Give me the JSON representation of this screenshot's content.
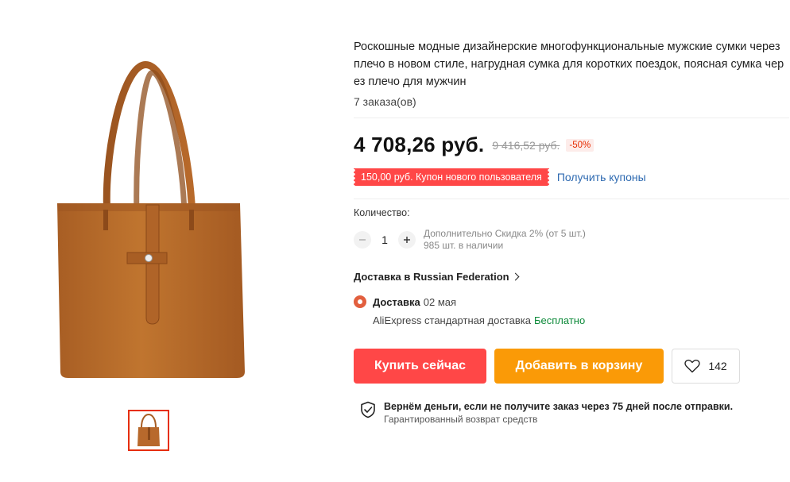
{
  "product": {
    "title": "Роскошные модные дизайнерские многофункциональные мужские сумки через плечо в новом стиле, нагрудная сумка для коротких поездок, поясная сумка через плечо для мужчин",
    "orders": "7 заказа(ов)"
  },
  "price": {
    "current": "4 708,26 руб.",
    "original": "9 416,52 руб.",
    "discount": "-50%"
  },
  "coupon": {
    "label": "150,00 руб. Купон нового пользователя",
    "link": "Получить купоны"
  },
  "quantity": {
    "label": "Количество:",
    "value": "1",
    "extra_discount": "Дополнительно Скидка 2% (от 5 шт.)",
    "stock": "985 шт. в наличии"
  },
  "shipping": {
    "title": "Доставка в Russian Federation",
    "delivery_label": "Доставка",
    "delivery_date": "02 мая",
    "service": "AliExpress стандартная доставка",
    "cost": "Бесплатно"
  },
  "actions": {
    "buy_now": "Купить сейчас",
    "add_to_cart": "Добавить в корзину",
    "wishlist_count": "142"
  },
  "guarantee": {
    "main": "Вернём деньги, если не получите заказ через 75 дней после отправки.",
    "sub": "Гарантированный возврат средств"
  },
  "icons": {
    "minus": "minus-icon",
    "plus": "plus-icon",
    "heart": "heart-icon",
    "shield": "shield-check-icon",
    "chevron": "chevron-right-icon"
  },
  "colors": {
    "buy": "#ff4747",
    "cart": "#fa9a07",
    "coupon": "#ff4747",
    "free": "#0d8a3a",
    "link": "#2e6ab1",
    "bag": "#b8692c"
  }
}
